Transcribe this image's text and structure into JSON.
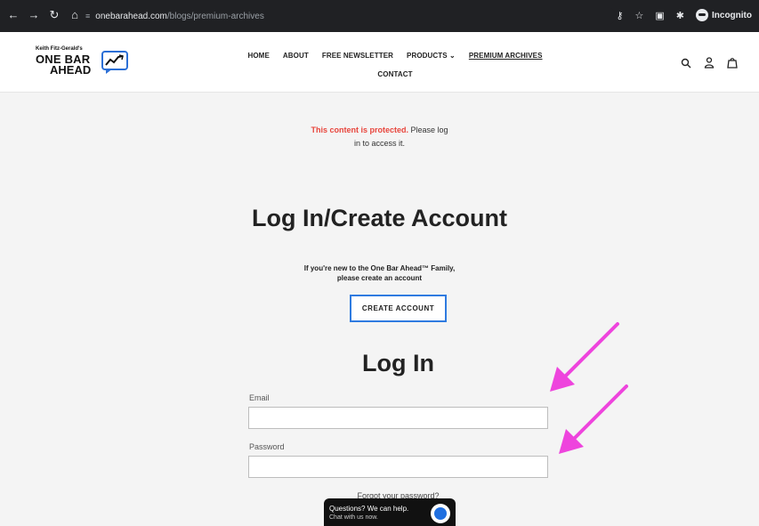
{
  "browser": {
    "url_host": "onebarahead.com",
    "url_path": "/blogs/premium-archives",
    "incognito_label": "Incognito"
  },
  "logo": {
    "tagline": "Keith Fitz-Gerald's",
    "line1": "ONE BAR",
    "line2": "AHEAD"
  },
  "nav": {
    "home": "HOME",
    "about": "ABOUT",
    "newsletter": "FREE NEWSLETTER",
    "products": "PRODUCTS",
    "premium": "PREMIUM ARCHIVES",
    "contact": "CONTACT"
  },
  "protected": {
    "highlight": "This content is protected.",
    "line1_rest": " Please log",
    "line2": "in to access it."
  },
  "page_title": "Log In/Create Account",
  "new_user": {
    "line1": "If you're new to the One Bar Ahead™ Family,",
    "line2": "please create an account"
  },
  "create_account_label": "CREATE ACCOUNT",
  "login_title": "Log In",
  "email": {
    "label": "Email",
    "value": ""
  },
  "password": {
    "label": "Password",
    "value": ""
  },
  "forgot_label": "Forgot your password?",
  "chat": {
    "line1": "Questions? We can help.",
    "line2": "Chat with us now."
  },
  "colors": {
    "protected_red": "#e8453c",
    "button_border_blue": "#2f7be0",
    "annotation_arrow": "#ee44dd"
  }
}
